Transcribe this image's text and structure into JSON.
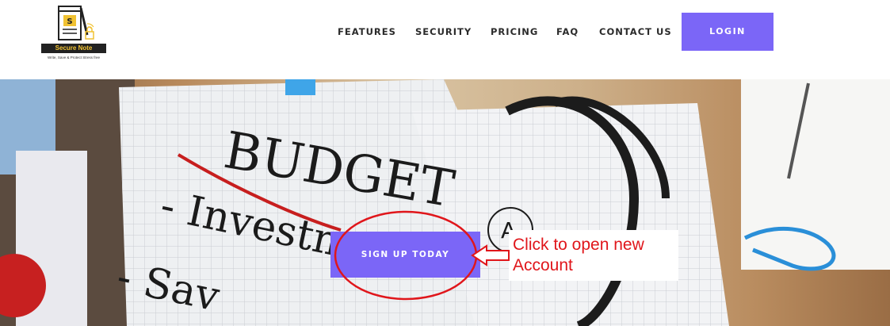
{
  "logo": {
    "name": "Secure Note",
    "tagline": "Write, Save & Protect Stress free",
    "icon": "notebook-lock-icon"
  },
  "nav": {
    "items": [
      {
        "label": "FEATURES"
      },
      {
        "label": "SECURITY"
      },
      {
        "label": "PRICING"
      },
      {
        "label": "FAQ"
      },
      {
        "label": "CONTACT US"
      }
    ],
    "login_label": "LOGIN"
  },
  "hero": {
    "signup_label": "SIGN UP TODAY",
    "annotation": {
      "line1": "Click to open new",
      "line2": "Account"
    },
    "photo_text": {
      "heading": "BUDGET",
      "line1": "- Investment",
      "line2": "- Sav",
      "letter": "A"
    }
  },
  "colors": {
    "accent": "#7b66f7",
    "annotation_red": "#e0161b",
    "logo_gold": "#f1c232"
  }
}
